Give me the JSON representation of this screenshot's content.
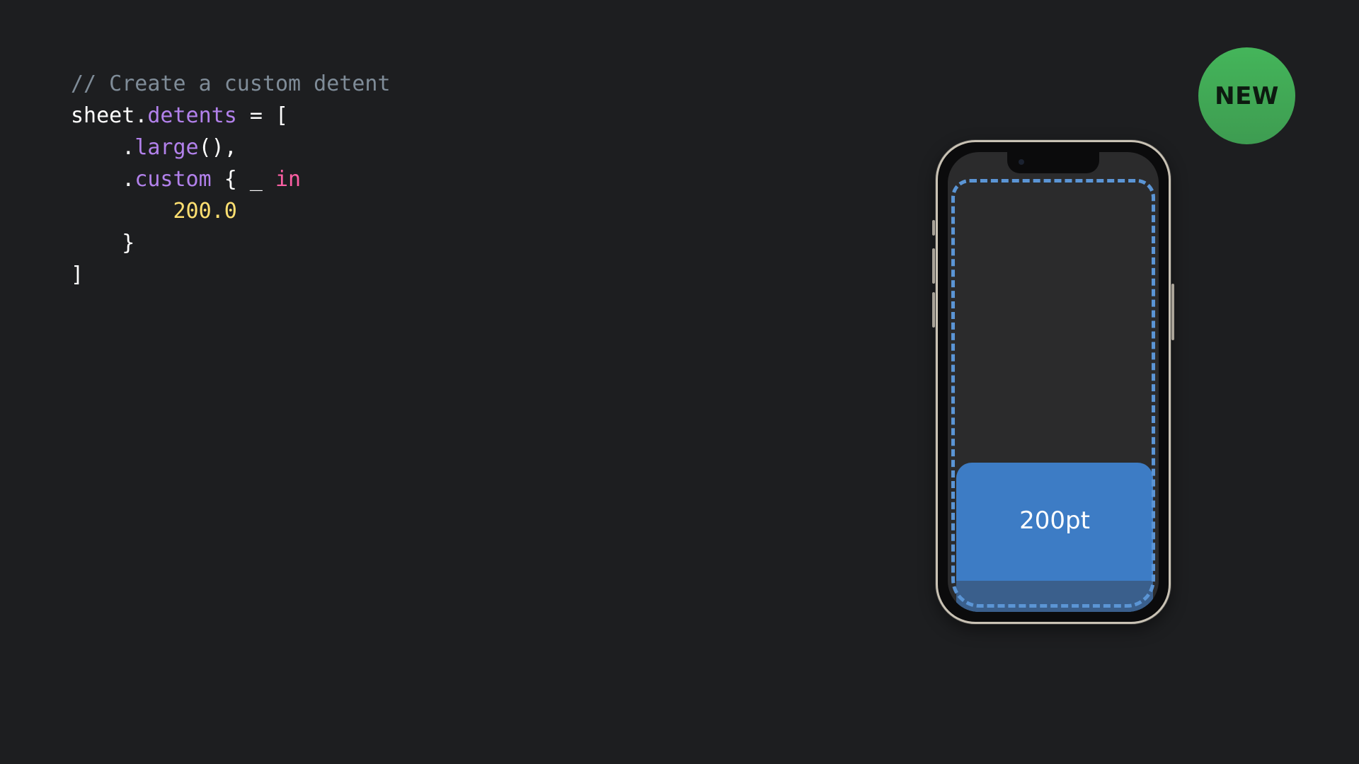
{
  "code": {
    "lines": [
      [
        {
          "t": "// Create a custom detent",
          "c": "comment"
        }
      ],
      [
        {
          "t": "sheet",
          "c": "plain"
        },
        {
          "t": ".",
          "c": "plain"
        },
        {
          "t": "detents",
          "c": "member"
        },
        {
          "t": " = [",
          "c": "plain"
        }
      ],
      [
        {
          "t": "    .",
          "c": "plain"
        },
        {
          "t": "large",
          "c": "member"
        },
        {
          "t": "(),",
          "c": "plain"
        }
      ],
      [
        {
          "t": "    .",
          "c": "plain"
        },
        {
          "t": "custom",
          "c": "member"
        },
        {
          "t": " { _ ",
          "c": "plain"
        },
        {
          "t": "in",
          "c": "keyword"
        }
      ],
      [
        {
          "t": "        ",
          "c": "plain"
        },
        {
          "t": "200.0",
          "c": "number"
        }
      ],
      [
        {
          "t": "    }",
          "c": "plain"
        }
      ],
      [
        {
          "t": "]",
          "c": "plain"
        }
      ]
    ]
  },
  "badge": {
    "label": "NEW",
    "color": "#44b55a"
  },
  "phone": {
    "sheet_label": "200pt",
    "sheet_color": "#3d7cc5",
    "safe_area_outline_color": "#5b95d5"
  },
  "colors": {
    "background": "#1d1e20",
    "comment": "#7f8c98",
    "member": "#b281eb",
    "keyword": "#fc5fa3",
    "number": "#ffe071"
  }
}
